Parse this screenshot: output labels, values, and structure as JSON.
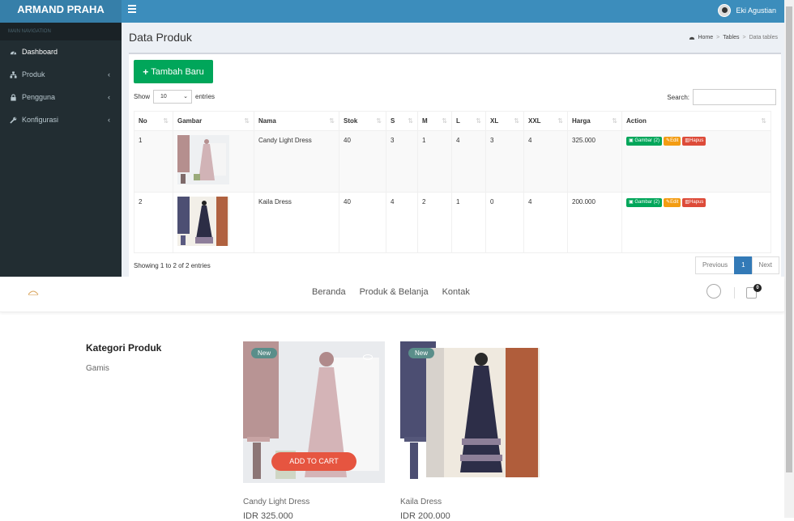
{
  "admin": {
    "logo": "ARMAND PRAHA",
    "user": "Eki Agustian",
    "sidebar": {
      "header": "MAIN NAVIGATION",
      "items": [
        {
          "label": "Dashboard"
        },
        {
          "label": "Produk"
        },
        {
          "label": "Pengguna"
        },
        {
          "label": "Konfigurasi"
        }
      ]
    },
    "page_title": "Data Produk",
    "breadcrumb": [
      "Home",
      "Tables",
      "Data tables"
    ],
    "add_button": "Tambah Baru",
    "show_label": "Show",
    "entries_value": "10",
    "entries_label": "entries",
    "search_label": "Search:",
    "table": {
      "headers": [
        "No",
        "Gambar",
        "Nama",
        "Stok",
        "S",
        "M",
        "L",
        "XL",
        "XXL",
        "Harga",
        "Action"
      ],
      "rows": [
        {
          "no": "1",
          "nama": "Candy Light Dress",
          "stok": "40",
          "s": "3",
          "m": "1",
          "l": "4",
          "xl": "3",
          "xxl": "4",
          "harga": "325.000"
        },
        {
          "no": "2",
          "nama": "Kaila Dress",
          "stok": "40",
          "s": "4",
          "m": "2",
          "l": "1",
          "xl": "0",
          "xxl": "4",
          "harga": "200.000"
        }
      ],
      "actions": {
        "gambar": "Gambar (2)",
        "edit": "Edit",
        "hapus": "Hapus"
      }
    },
    "showing": "Showing 1 to 2 of 2 entries",
    "pager": {
      "prev": "Previous",
      "page": "1",
      "next": "Next"
    }
  },
  "shop": {
    "menu": [
      "Beranda",
      "Produk & Belanja",
      "Kontak"
    ],
    "cart_count": "0",
    "category_title": "Kategori Produk",
    "category_item": "Gamis",
    "products": [
      {
        "badge": "New",
        "name": "Candy Light Dress",
        "price": "IDR 325.000",
        "button": "ADD TO CART"
      },
      {
        "badge": "New",
        "name": "Kaila Dress",
        "price": "IDR 200.000"
      }
    ]
  }
}
